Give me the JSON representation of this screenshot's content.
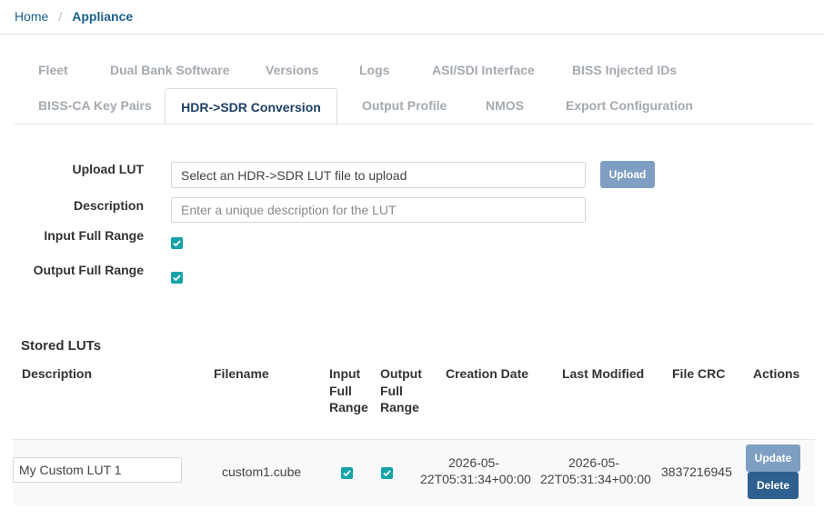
{
  "breadcrumb": {
    "home": "Home",
    "separator": "/",
    "current": "Appliance"
  },
  "tabs": {
    "row1": [
      "Fleet",
      "Dual Bank Software",
      "Versions",
      "Logs",
      "ASI/SDI Interface",
      "BISS Injected IDs"
    ],
    "row2": [
      "BISS-CA Key Pairs",
      "HDR->SDR Conversion",
      "Output Profile",
      "NMOS",
      "Export Configuration"
    ],
    "active": "HDR->SDR Conversion"
  },
  "form": {
    "upload_lut_label": "Upload LUT",
    "file_prompt": "Select an HDR->SDR LUT file to upload",
    "upload_button": "Upload",
    "description_label": "Description",
    "description_placeholder": "Enter a unique description for the LUT",
    "description_value": "",
    "input_full_range_label": "Input Full Range",
    "input_full_range_checked": true,
    "output_full_range_label": "Output Full Range",
    "output_full_range_checked": true
  },
  "stored": {
    "title": "Stored LUTs",
    "headers": {
      "description": "Description",
      "filename": "Filename",
      "input_full_range": [
        "Input",
        "Full",
        "Range"
      ],
      "output_full_range": [
        "Output",
        "Full",
        "Range"
      ],
      "creation_date": "Creation Date",
      "last_modified": "Last Modified",
      "file_crc": "File CRC",
      "actions": "Actions"
    },
    "rows": [
      {
        "description": "My Custom LUT 1",
        "filename": "custom1.cube",
        "input_full_range": true,
        "output_full_range": true,
        "creation_date": [
          "2026-05-",
          "22T05:31:34+00:00"
        ],
        "last_modified": [
          "2026-05-",
          "22T05:31:34+00:00"
        ],
        "file_crc": "3837216945",
        "update_button": "Update",
        "delete_button": "Delete"
      }
    ]
  },
  "colors": {
    "primary_dark": "#2e5f8f",
    "primary_light": "#7f9fc2",
    "checkbox": "#17a2a8",
    "link": "#1a5f8a"
  },
  "icons": {
    "checkbox": "check-icon"
  }
}
